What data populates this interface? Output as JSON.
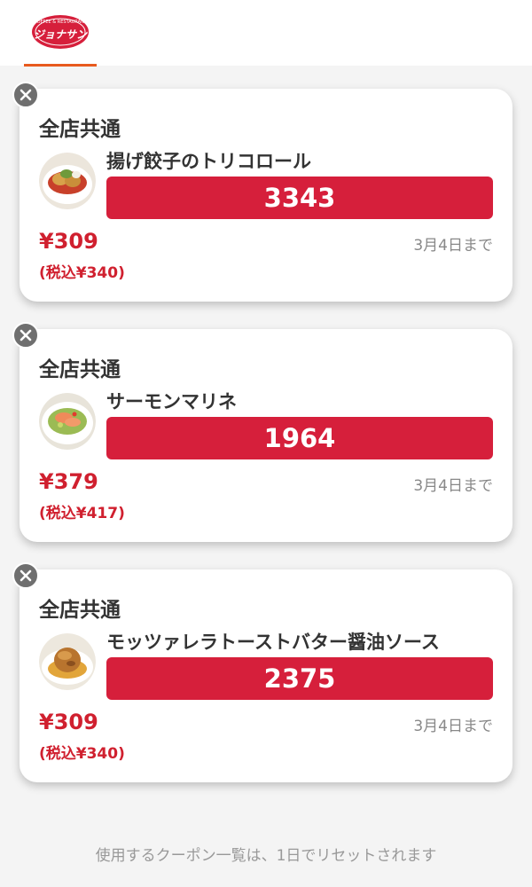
{
  "header": {
    "logo_text": "ジョナサン",
    "logo_subtext": "COFFEE & RESTAURANT"
  },
  "coupons": [
    {
      "area": "全店共通",
      "name": "揚げ餃子のトリコロール",
      "code": "3343",
      "price": "¥309",
      "price_tax": "(税込¥340)",
      "expiry": "3月4日まで"
    },
    {
      "area": "全店共通",
      "name": "サーモンマリネ",
      "code": "1964",
      "price": "¥379",
      "price_tax": "(税込¥417)",
      "expiry": "3月4日まで"
    },
    {
      "area": "全店共通",
      "name": "モッツァレラトーストバター醤油ソース",
      "code": "2375",
      "price": "¥309",
      "price_tax": "(税込¥340)",
      "expiry": "3月4日まで"
    }
  ],
  "footer": {
    "note": "使用するクーポン一覧は、1日でリセットされます"
  },
  "colors": {
    "accent_red": "#d61f3b",
    "price_red": "#d0202f",
    "tab_orange": "#e85a1e"
  },
  "icons": {
    "close": "close-icon",
    "logo": "jonathan-logo"
  }
}
